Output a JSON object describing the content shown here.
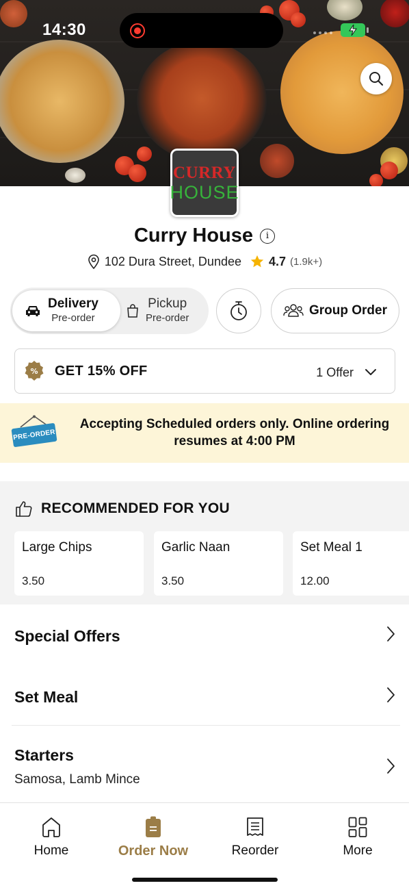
{
  "status_bar": {
    "time": "14:30"
  },
  "restaurant": {
    "logo_line1": "CURRY",
    "logo_line2": "HOUSE",
    "name": "Curry House",
    "address": "102 Dura Street, Dundee",
    "rating": "4.7",
    "rating_count": "(1.9k+)"
  },
  "order_modes": {
    "delivery_label": "Delivery",
    "delivery_sub": "Pre-order",
    "pickup_label": "Pickup",
    "pickup_sub": "Pre-order",
    "group_order_label": "Group Order"
  },
  "offer": {
    "title": "GET 15% OFF",
    "count": "1 Offer",
    "badge_symbol": "%"
  },
  "banner": {
    "badge_text": "PRE-ORDER",
    "message": "Accepting Scheduled orders only. Online ordering resumes at 4:00 PM"
  },
  "recommended": {
    "title": "RECOMMENDED FOR YOU",
    "items": [
      {
        "name": "Large Chips",
        "price": "3.50"
      },
      {
        "name": "Garlic Naan",
        "price": "3.50"
      },
      {
        "name": "Set Meal 1",
        "price": "12.00"
      }
    ]
  },
  "categories": [
    {
      "title": "Special Offers",
      "subtitle": ""
    },
    {
      "title": "Set Meal",
      "subtitle": ""
    },
    {
      "title": "Starters",
      "subtitle": "Samosa, Lamb Mince"
    }
  ],
  "tabs": [
    {
      "label": "Home",
      "icon": "home-icon",
      "active": false
    },
    {
      "label": "Order Now",
      "icon": "order-bag-icon",
      "active": true
    },
    {
      "label": "Reorder",
      "icon": "receipt-icon",
      "active": false
    },
    {
      "label": "More",
      "icon": "grid-icon",
      "active": false
    }
  ],
  "colors": {
    "accent": "#9b7d47",
    "banner_bg": "#fdf5d8",
    "star": "#f5b301",
    "preorder_badge": "#2a8cbf"
  }
}
